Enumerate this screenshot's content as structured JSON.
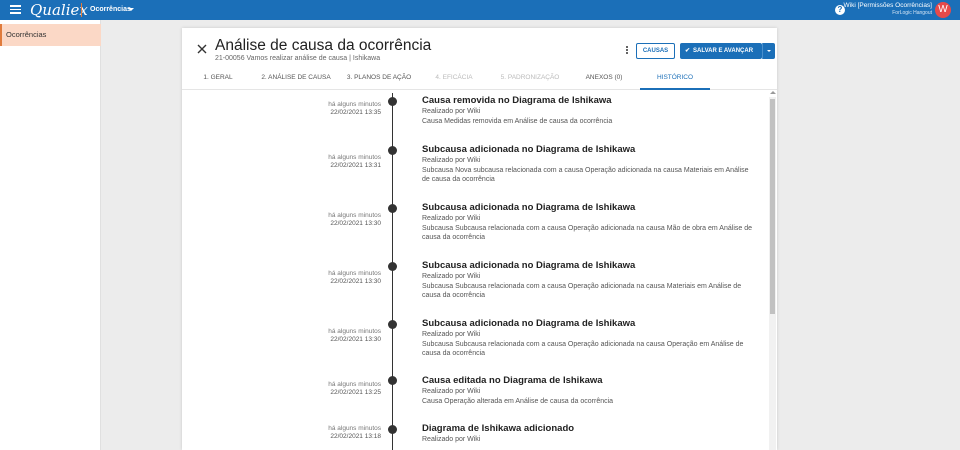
{
  "topbar": {
    "logo": "Qualiex",
    "module": "Ocorrências",
    "user_name": "Wiki [Permissões Ocorrências]",
    "user_company": "ForLogic Hangout",
    "avatar_letter": "W",
    "brand_color": "#1b6fb8",
    "accent_color": "#e07b3c"
  },
  "sidebar": {
    "items": [
      {
        "label": "Ocorrências"
      }
    ]
  },
  "header": {
    "title": "Análise de causa da ocorrência",
    "subtitle": "21-00056 Vamos realizar análise de causa | Ishikawa",
    "causas_label": "CAUSAS",
    "save_label": "SALVAR E AVANÇAR"
  },
  "tabs": [
    {
      "label": "1. GERAL",
      "state": "normal"
    },
    {
      "label": "2. ANÁLISE DE CAUSA",
      "state": "normal"
    },
    {
      "label": "3. PLANOS DE AÇÃO",
      "state": "normal"
    },
    {
      "label": "4. EFICÁCIA",
      "state": "disabled"
    },
    {
      "label": "5. PADRONIZAÇÃO",
      "state": "disabled"
    },
    {
      "label": "ANEXOS (0)",
      "state": "normal"
    },
    {
      "label": "HISTÓRICO",
      "state": "active"
    }
  ],
  "events": [
    {
      "ago": "há alguns minutos",
      "date": "22/02/2021 13:35",
      "title": "Causa removida no Diagrama de Ishikawa",
      "by": "Realizado por Wiki",
      "desc": "Causa Medidas removida em Análise de causa da ocorrência"
    },
    {
      "ago": "há alguns minutos",
      "date": "22/02/2021 13:31",
      "title": "Subcausa adicionada no Diagrama de Ishikawa",
      "by": "Realizado por Wiki",
      "desc": "Subcausa Nova subcausa relacionada com a causa Operação adicionada na causa Materiais em Análise de causa da ocorrência"
    },
    {
      "ago": "há alguns minutos",
      "date": "22/02/2021 13:30",
      "title": "Subcausa adicionada no Diagrama de Ishikawa",
      "by": "Realizado por Wiki",
      "desc": "Subcausa Subcausa relacionada com a causa Operação adicionada na causa Mão de obra em Análise de causa da ocorrência"
    },
    {
      "ago": "há alguns minutos",
      "date": "22/02/2021 13:30",
      "title": "Subcausa adicionada no Diagrama de Ishikawa",
      "by": "Realizado por Wiki",
      "desc": "Subcausa Subcausa relacionada com a causa Operação adicionada na causa Materiais em Análise de causa da ocorrência"
    },
    {
      "ago": "há alguns minutos",
      "date": "22/02/2021 13:30",
      "title": "Subcausa adicionada no Diagrama de Ishikawa",
      "by": "Realizado por Wiki",
      "desc": "Subcausa Subcausa relacionada com a causa Operação adicionada na causa Operação em Análise de causa da ocorrência"
    },
    {
      "ago": "há alguns minutos",
      "date": "22/02/2021 13:25",
      "title": "Causa editada no Diagrama de Ishikawa",
      "by": "Realizado por Wiki",
      "desc": "Causa Operação alterada em Análise de causa da ocorrência"
    },
    {
      "ago": "há alguns minutos",
      "date": "22/02/2021 13:18",
      "title": "Diagrama de Ishikawa adicionado",
      "by": "Realizado por Wiki",
      "desc": ""
    }
  ]
}
